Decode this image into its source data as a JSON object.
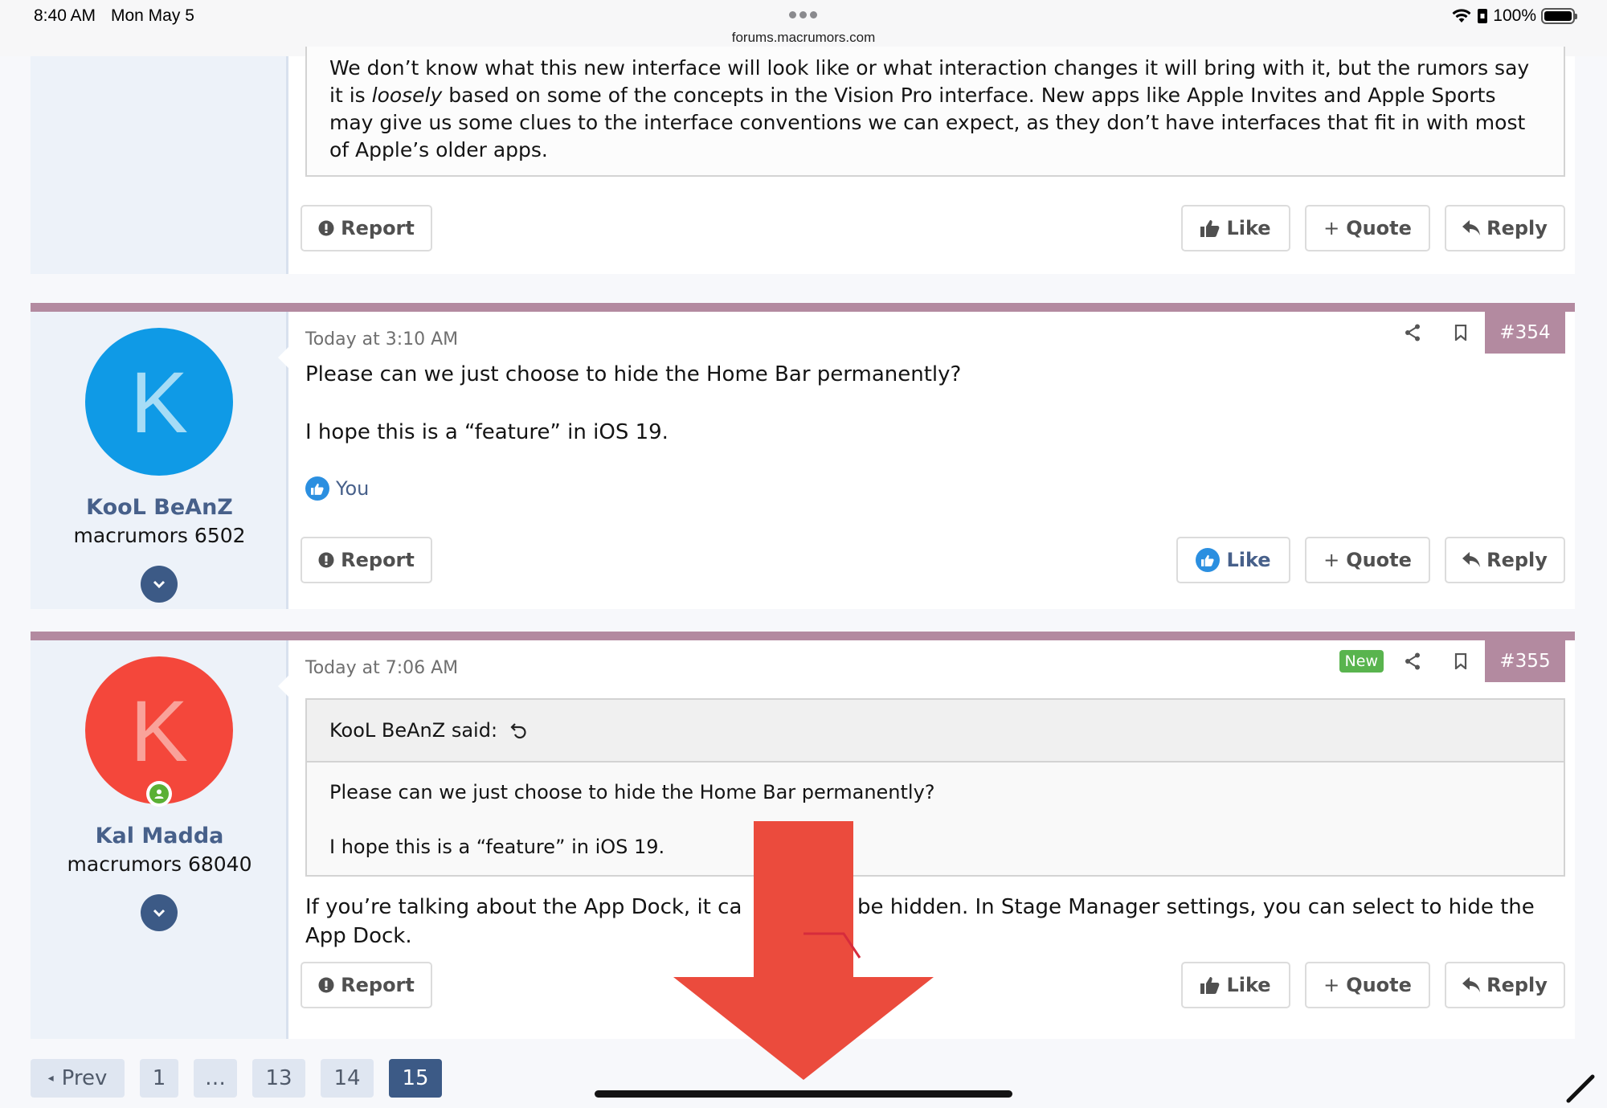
{
  "status_bar": {
    "time": "8:40 AM",
    "date": "Mon May 5",
    "url": "forums.macrumors.com",
    "battery": "100%"
  },
  "top_post": {
    "paragraph_1": "We don’t know what this new interface will look like or what interaction changes it will bring with it, but the rumors say it is ",
    "paragraph_em": "loosely",
    "paragraph_2": " based on some of the concepts in the Vision Pro interface. New apps like Apple Invites and Apple Sports may give us some clues to the interface conventions we can expect, as they don’t have interfaces that fit in with most of Apple’s older apps."
  },
  "buttons": {
    "report": "Report",
    "like": "Like",
    "quote": "Quote",
    "reply": "Reply"
  },
  "posts": [
    {
      "avatar_letter": "K",
      "avatar_color": "#0f9ae6",
      "avatar_letter_color": "#a6dcf6",
      "username": "KooL BeAnZ",
      "user_title": "macrumors 6502",
      "date": "Today at 3:10 AM",
      "number": "#354",
      "line_1": "Please can we just choose to hide the Home Bar permanently?",
      "line_2": "I hope this is a “feature” in iOS 19.",
      "reaction": "You"
    },
    {
      "avatar_letter": "K",
      "avatar_color": "#f4473b",
      "avatar_letter_color": "#f9a29a",
      "username": "Kal Madda",
      "user_title": "macrumors 68040",
      "date": "Today at 7:06 AM",
      "number": "#355",
      "new_badge": "New",
      "quote_author": "KooL BeAnZ said:",
      "quote_line_1": "Please can we just choose to hide the Home Bar permanently?",
      "quote_line_2": "I hope this is a “feature” in iOS 19.",
      "reply_text": "If you’re talking about the App Dock, it ca",
      "reply_text_after": "y be hidden. In Stage Manager settings, you can select to hide the App Dock."
    }
  ],
  "pagination": {
    "prev": "Prev",
    "pages": [
      "1",
      "…",
      "13",
      "14",
      "15"
    ],
    "current": "15"
  },
  "colors": {
    "post_bar": "#b38aa0",
    "accent": "#3c5a86",
    "overlay_arrow": "#eb4b3d",
    "new_badge": "#59b44e"
  }
}
